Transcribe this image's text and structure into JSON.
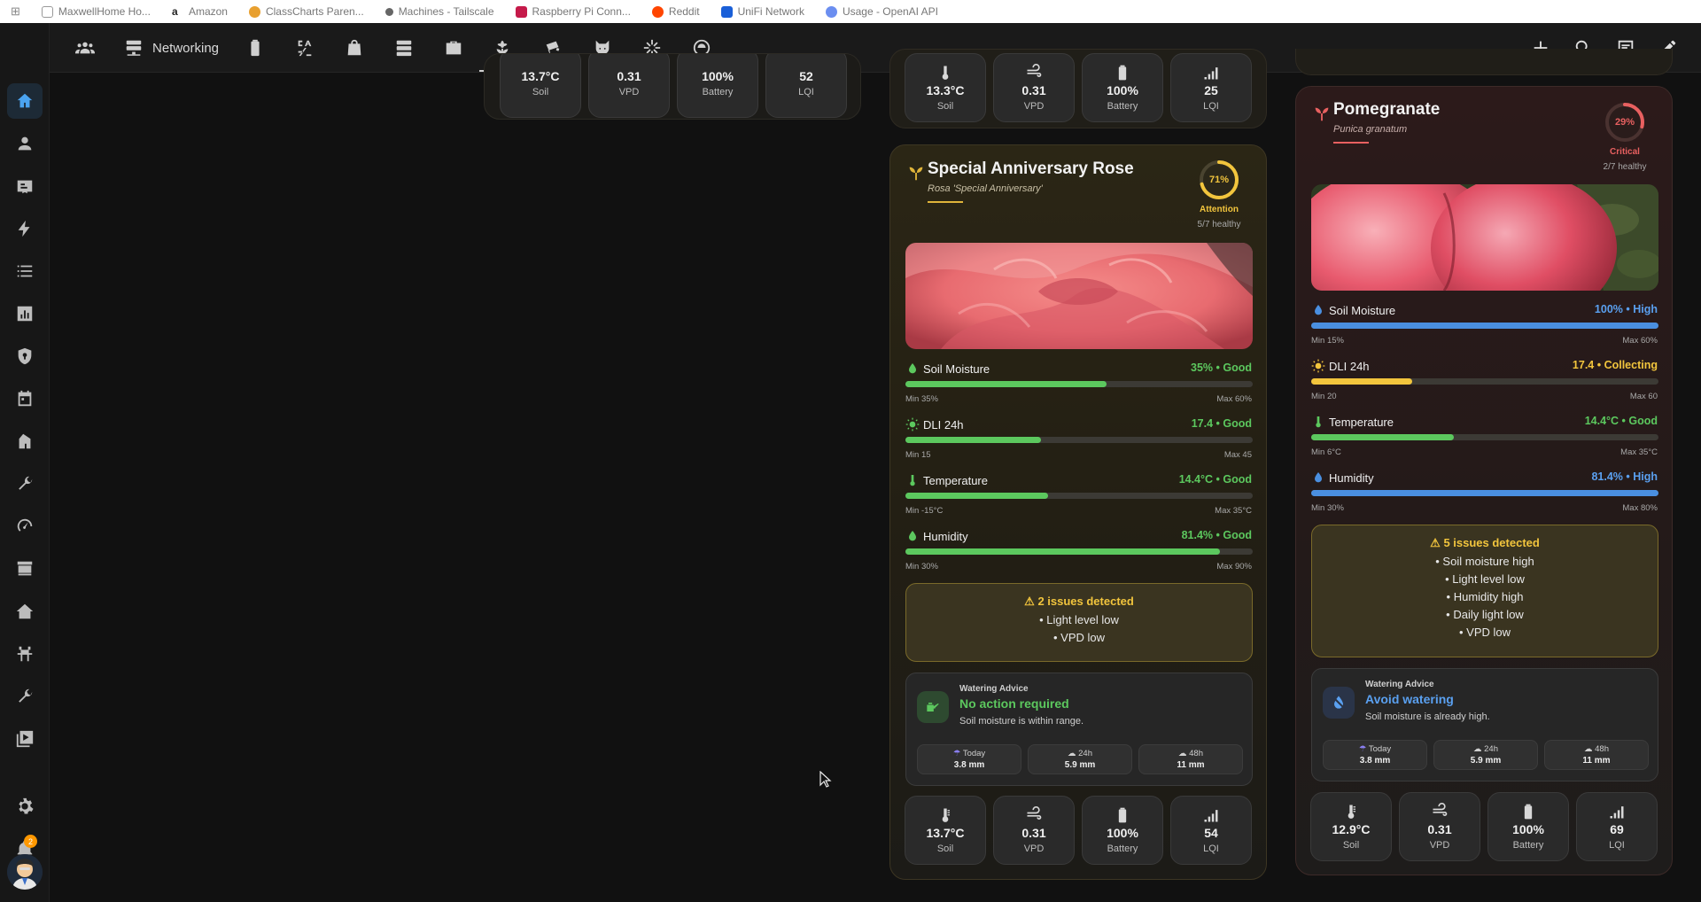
{
  "bookmarks": [
    "MaxwellHome Ho...",
    "Amazon",
    "ClassCharts Paren...",
    "Machines - Tailscale",
    "Raspberry Pi Conn...",
    "Reddit",
    "UniFi Network",
    "Usage - OpenAI API"
  ],
  "topbar": {
    "networking_label": "Networking",
    "tab_icons": [
      "group-icon",
      "server-icon",
      "battery-icon",
      "ac-icon",
      "bag-icon",
      "storage-icon",
      "toolbox-icon",
      "flower-icon",
      "cctv-icon",
      "cat-icon",
      "sparkle-icon",
      "robot-vacuum-icon"
    ]
  },
  "sidebar": {
    "icons": [
      "home-icon",
      "person-icon",
      "badge-icon",
      "lightning-icon",
      "list-icon",
      "chart-icon",
      "shield-icon",
      "calendar-icon",
      "home-alt-icon",
      "wrench-icon",
      "gauge-icon",
      "hacs-icon",
      "house-icon",
      "garden-icon",
      "tools-icon",
      "media-icon"
    ],
    "notification_count": "2"
  },
  "top_card_1": {
    "sensors": [
      {
        "value": "13.7°C",
        "name": "Soil"
      },
      {
        "value": "0.31",
        "name": "VPD"
      },
      {
        "value": "100%",
        "name": "Battery"
      },
      {
        "value": "52",
        "name": "LQI"
      }
    ]
  },
  "top_card_2": {
    "sensors": [
      {
        "value": "13.3°C",
        "name": "Soil"
      },
      {
        "value": "0.31",
        "name": "VPD"
      },
      {
        "value": "100%",
        "name": "Battery"
      },
      {
        "value": "25",
        "name": "LQI"
      }
    ]
  },
  "rose": {
    "title": "Special Anniversary Rose",
    "latin": "Rosa 'Special Anniversary'",
    "score": "71%",
    "score_value": 0.71,
    "status": "Attention",
    "healthy": "5/7 healthy",
    "accent": "#f2c53d",
    "metrics": [
      {
        "name": "Soil Moisture",
        "value": "35% • Good",
        "min": "Min 35%",
        "max": "Max 60%",
        "fill": 0.58,
        "color": "#5cc85e"
      },
      {
        "name": "DLI 24h",
        "value": "17.4 • Good",
        "min": "Min 15",
        "max": "Max 45",
        "fill": 0.39,
        "color": "#5cc85e"
      },
      {
        "name": "Temperature",
        "value": "14.4°C • Good",
        "min": "Min -15°C",
        "max": "Max 35°C",
        "fill": 0.41,
        "color": "#5cc85e"
      },
      {
        "name": "Humidity",
        "value": "81.4% • Good",
        "min": "Min 30%",
        "max": "Max 90%",
        "fill": 0.905,
        "color": "#5cc85e"
      }
    ],
    "issues_head": "⚠ 2 issues detected",
    "issues": [
      "• Light level low",
      "• VPD low"
    ],
    "watering": {
      "label": "Watering Advice",
      "head": "No action required",
      "desc": "Soil moisture is within range.",
      "forecast": [
        {
          "t": "Today",
          "v": "3.8 mm"
        },
        {
          "t": "24h",
          "v": "5.9 mm"
        },
        {
          "t": "48h",
          "v": "11 mm"
        }
      ]
    },
    "sensors": [
      {
        "value": "13.7°C",
        "name": "Soil"
      },
      {
        "value": "0.31",
        "name": "VPD"
      },
      {
        "value": "100%",
        "name": "Battery"
      },
      {
        "value": "54",
        "name": "LQI"
      }
    ]
  },
  "pomegranate": {
    "title": "Pomegranate",
    "latin": "Punica granatum",
    "score": "29%",
    "score_value": 0.29,
    "status": "Critical",
    "healthy": "2/7 healthy",
    "accent": "#e86060",
    "metrics": [
      {
        "name": "Soil Moisture",
        "value": "100% • High",
        "min": "Min 15%",
        "max": "Max 60%",
        "fill": 1.0,
        "color": "#4a8fe0",
        "valcolor": "#5aa0f0"
      },
      {
        "name": "DLI 24h",
        "value": "17.4 • Collecting",
        "min": "Min 20",
        "max": "Max 60",
        "fill": 0.29,
        "color": "#f2c53d",
        "valcolor": "#f2c53d"
      },
      {
        "name": "Temperature",
        "value": "14.4°C • Good",
        "min": "Min 6°C",
        "max": "Max 35°C",
        "fill": 0.41,
        "color": "#5cc85e",
        "valcolor": "#5cc85e"
      },
      {
        "name": "Humidity",
        "value": "81.4% • High",
        "min": "Min 30%",
        "max": "Max 80%",
        "fill": 1.0,
        "color": "#4a8fe0",
        "valcolor": "#5aa0f0"
      }
    ],
    "issues_head": "⚠ 5 issues detected",
    "issues": [
      "• Soil moisture high",
      "• Light level low",
      "• Humidity high",
      "• Daily light low",
      "• VPD low"
    ],
    "watering": {
      "label": "Watering Advice",
      "head": "Avoid watering",
      "desc": "Soil moisture is already high.",
      "forecast": [
        {
          "t": "Today",
          "v": "3.8 mm"
        },
        {
          "t": "24h",
          "v": "5.9 mm"
        },
        {
          "t": "48h",
          "v": "11 mm"
        }
      ]
    },
    "sensors": [
      {
        "value": "12.9°C",
        "name": "Soil"
      },
      {
        "value": "0.31",
        "name": "VPD"
      },
      {
        "value": "100%",
        "name": "Battery"
      },
      {
        "value": "69",
        "name": "LQI"
      }
    ]
  }
}
